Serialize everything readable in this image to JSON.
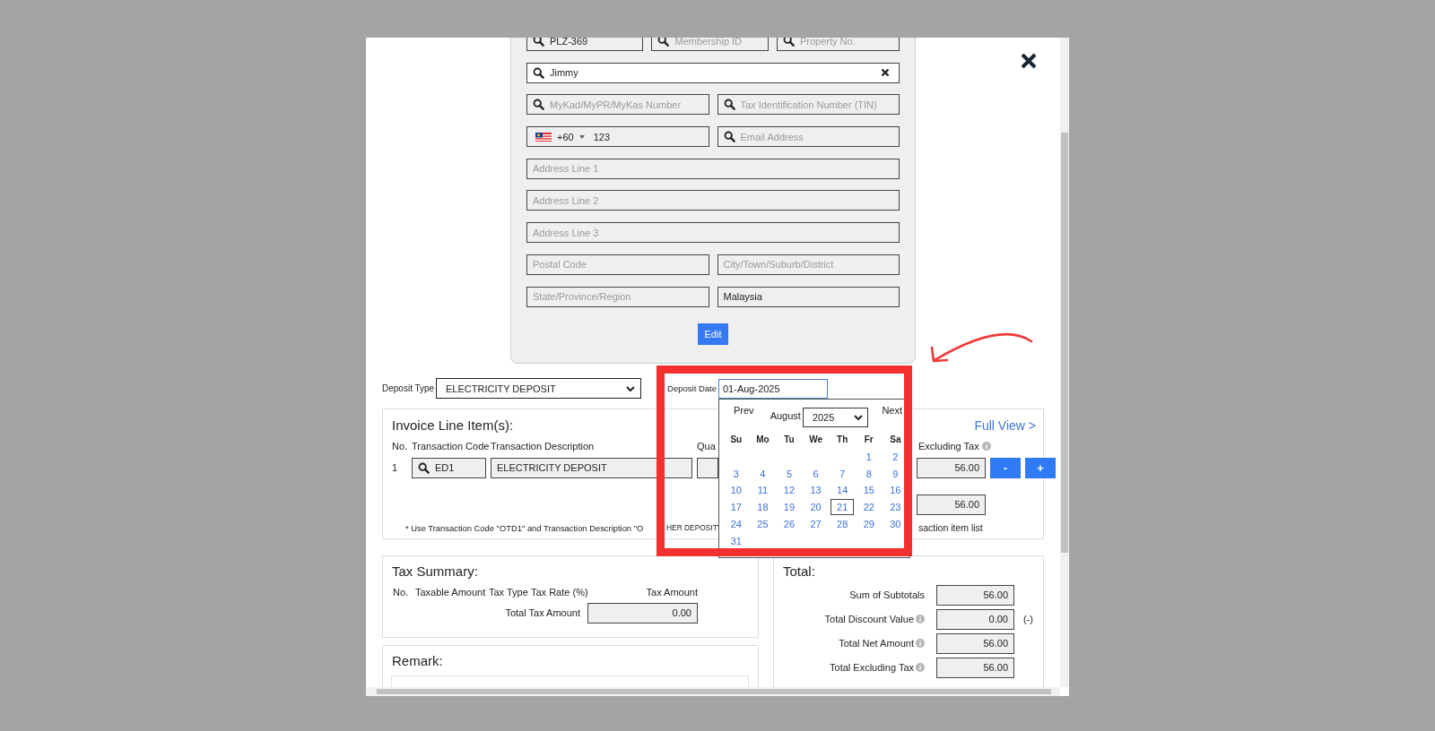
{
  "customer": {
    "rows": [
      [
        {
          "kind": "search",
          "value": "PLZ-369"
        },
        {
          "kind": "search",
          "placeholder": "Membership ID"
        },
        {
          "kind": "search",
          "placeholder": "Property No."
        }
      ],
      [
        {
          "kind": "search_clear",
          "value": "Jimmy"
        }
      ],
      [
        {
          "kind": "search",
          "placeholder": "MyKad/MyPR/MyKas Number"
        },
        {
          "kind": "search",
          "placeholder": "Tax Identification Number (TIN)"
        }
      ],
      [
        {
          "kind": "phone",
          "country_code": "+60",
          "value": "123"
        },
        {
          "kind": "search",
          "placeholder": "Email Address"
        }
      ],
      [
        {
          "kind": "text",
          "placeholder": "Address Line 1"
        }
      ],
      [
        {
          "kind": "text",
          "placeholder": "Address Line 2"
        }
      ],
      [
        {
          "kind": "text",
          "placeholder": "Address Line 3"
        }
      ],
      [
        {
          "kind": "text",
          "placeholder": "Postal Code"
        },
        {
          "kind": "text",
          "placeholder": "City/Town/Suburb/District"
        }
      ],
      [
        {
          "kind": "text",
          "placeholder": "State/Province/Region"
        },
        {
          "kind": "text",
          "value": "Malaysia"
        }
      ]
    ],
    "edit_button": "Edit"
  },
  "deposit": {
    "type_label": "Deposit Type",
    "type_value": "ELECTRICITY DEPOSIT",
    "date_label": "Deposit Date",
    "date_value": "01-Aug-2025"
  },
  "datepicker": {
    "prev": "Prev",
    "next": "Next",
    "month": "August",
    "year": "2025",
    "weekdays": [
      "Su",
      "Mo",
      "Tu",
      "We",
      "Th",
      "Fr",
      "Sa"
    ],
    "weeks": [
      [
        {
          "label": "1",
          "selected": false
        },
        {
          "label": "2",
          "selected": false
        }
      ],
      [
        {
          "label": "3",
          "selected": false
        },
        {
          "label": "4",
          "selected": false
        },
        {
          "label": "5",
          "selected": false
        },
        {
          "label": "6",
          "selected": false
        },
        {
          "label": "7",
          "selected": false
        },
        {
          "label": "8",
          "selected": false
        },
        {
          "label": "9",
          "selected": false
        }
      ],
      [
        {
          "label": "10",
          "selected": false
        },
        {
          "label": "11",
          "selected": false
        },
        {
          "label": "12",
          "selected": false
        },
        {
          "label": "13",
          "selected": false
        },
        {
          "label": "14",
          "selected": false
        },
        {
          "label": "15",
          "selected": false
        },
        {
          "label": "16",
          "selected": false
        }
      ],
      [
        {
          "label": "17",
          "selected": false
        },
        {
          "label": "18",
          "selected": false
        },
        {
          "label": "19",
          "selected": false
        },
        {
          "label": "20",
          "selected": false
        },
        {
          "label": "21",
          "selected": true
        },
        {
          "label": "22",
          "selected": false
        },
        {
          "label": "23",
          "selected": false
        }
      ],
      [
        {
          "label": "24",
          "selected": false
        },
        {
          "label": "25",
          "selected": false
        },
        {
          "label": "26",
          "selected": false
        },
        {
          "label": "27",
          "selected": false
        },
        {
          "label": "28",
          "selected": false
        },
        {
          "label": "29",
          "selected": false
        },
        {
          "label": "30",
          "selected": false
        }
      ],
      [
        {
          "label": "31",
          "selected": false
        }
      ]
    ]
  },
  "invoice": {
    "title": "Invoice Line Item(s):",
    "full_view": "Full View >",
    "columns": [
      "No.",
      "Transaction Code",
      "Transaction Description",
      "Qua",
      "Excluding Tax"
    ],
    "subtotal_info": true,
    "rows": [
      {
        "no": "1",
        "code": "ED1",
        "description": "ELECTRICITY DEPOSIT",
        "subtotal": "56.00",
        "remove": "-",
        "add": "+"
      }
    ],
    "total": "56.00",
    "note": [
      "* Use Transaction Code \"OTD1\" and Transaction Description \"O",
      "HER DEPOSIT\"",
      "saction item list"
    ]
  },
  "tax_summary": {
    "title": "Tax Summary:",
    "columns": [
      "No.",
      "Taxable Amount",
      "Tax Type",
      "Tax Rate (%)",
      "Tax Amount"
    ],
    "total_label": "Total Tax Amount",
    "total_value": "0.00"
  },
  "remark": {
    "title": "Remark:"
  },
  "totals": {
    "title": "Total:",
    "rows": [
      {
        "label": "Sum of Subtotals",
        "value": "56.00",
        "info": false
      },
      {
        "label": "Total Discount Value",
        "value": "0.00",
        "info": true,
        "suffix": "(-)"
      },
      {
        "label": "Total Net Amount",
        "value": "56.00",
        "info": true
      },
      {
        "label": "Total Excluding Tax",
        "value": "56.00",
        "info": true
      }
    ]
  }
}
